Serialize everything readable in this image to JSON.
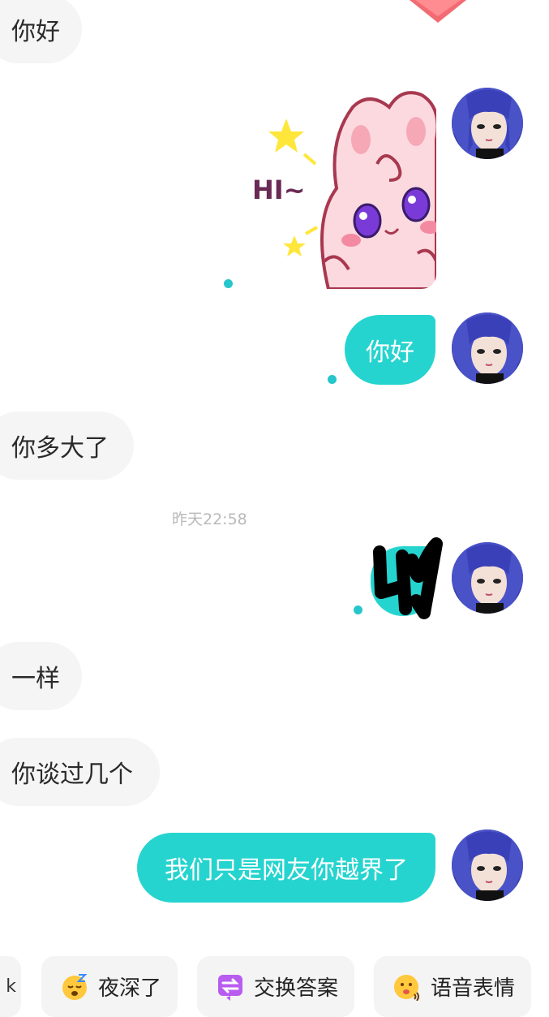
{
  "messages": [
    {
      "type": "incoming",
      "text": "你好"
    },
    {
      "type": "outgoing_sticker",
      "sticker_text": "HI~"
    },
    {
      "type": "outgoing",
      "text": "你好"
    },
    {
      "type": "incoming",
      "text": "你多大了"
    },
    {
      "type": "timestamp",
      "text": "昨天22:58"
    },
    {
      "type": "outgoing_redacted"
    },
    {
      "type": "incoming",
      "text": "一样"
    },
    {
      "type": "incoming",
      "text": "你谈过几个"
    },
    {
      "type": "outgoing",
      "text": "我们只是网友你越界了"
    }
  ],
  "quick_replies": [
    {
      "label": "k",
      "icon": "partial-chip"
    },
    {
      "label": "夜深了",
      "icon": "sleepy-face-icon"
    },
    {
      "label": "交换答案",
      "icon": "exchange-icon"
    },
    {
      "label": "语音表情",
      "icon": "voice-emoji-icon"
    }
  ],
  "colors": {
    "outgoing_bubble": "#26d4cf",
    "incoming_bubble": "#f5f5f5",
    "read_dot": "#26c6cc"
  }
}
